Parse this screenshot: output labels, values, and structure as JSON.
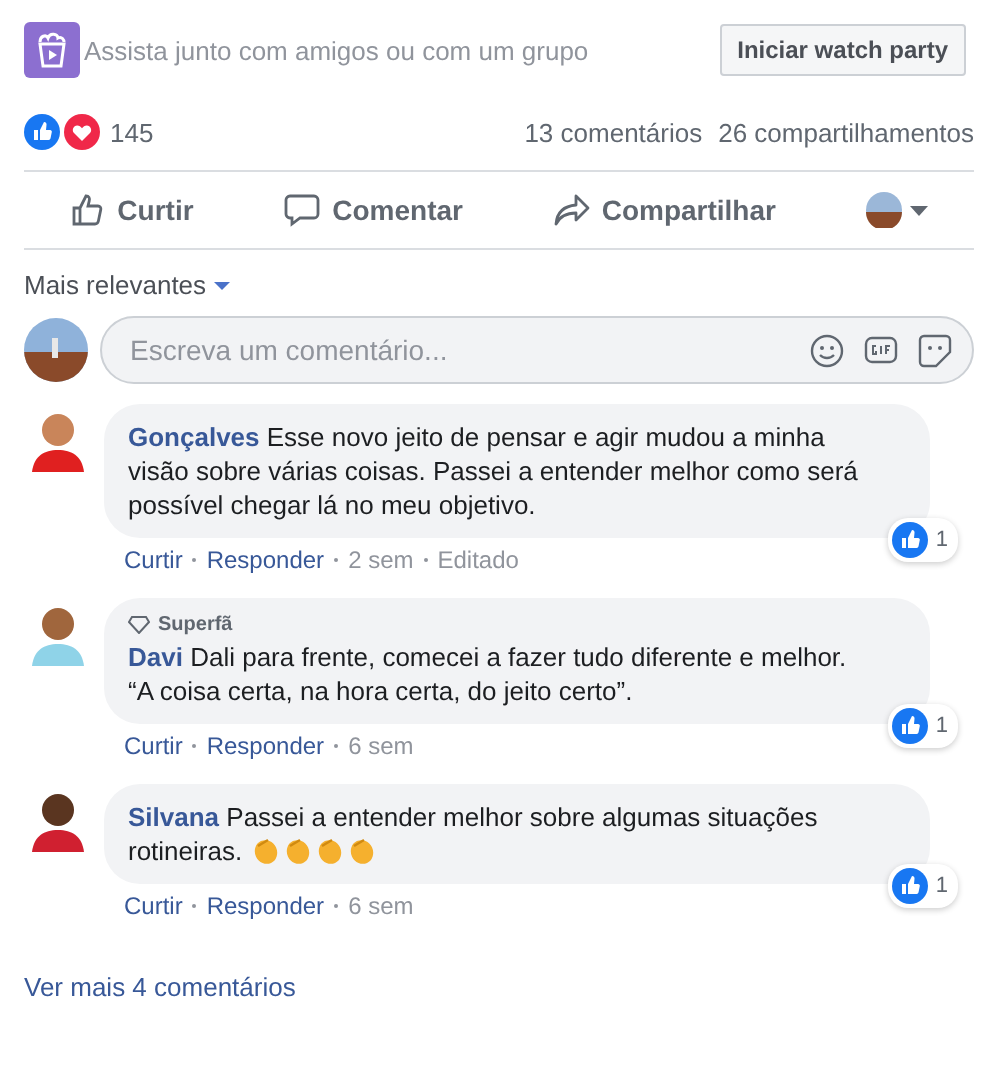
{
  "watch_party": {
    "text": "Assista junto com amigos ou com um grupo",
    "button": "Iniciar watch party"
  },
  "reactions": {
    "icons": [
      {
        "kind": "like"
      },
      {
        "kind": "love"
      }
    ],
    "count": "145",
    "comments": "13 comentários",
    "shares": "26 compartilhamentos"
  },
  "actions": [
    "Curtir",
    "Comentar",
    "Compartilhar"
  ],
  "sort": {
    "label": "Mais relevantes"
  },
  "composer": {
    "placeholder": "Escreva um comentário..."
  },
  "comments": [
    {
      "author": "Gonçalves",
      "text": "Esse novo jeito de pensar e agir mudou a minha visão sobre várias coisas. Passei a entender melhor como será possível chegar lá no meu objetivo.",
      "actions": [
        "Curtir",
        "Responder",
        "2 sem",
        "Editado"
      ],
      "likes": "1"
    },
    {
      "author": "Davi",
      "badge": "Superfã",
      "text": "Dali para frente, comecei a fazer tudo diferente e melhor. “A coisa certa, na hora certa, do jeito certo”.",
      "actions": [
        "Curtir",
        "Responder",
        "6 sem"
      ],
      "likes": "1"
    },
    {
      "author": "Silvana",
      "text": "Passei a entender melhor sobre algumas situações rotineiras.",
      "emojis": [
        {
          "kind": "clap"
        },
        {
          "kind": "clap"
        },
        {
          "kind": "clap"
        },
        {
          "kind": "clap"
        }
      ],
      "actions": [
        "Curtir",
        "Responder",
        "6 sem"
      ],
      "likes": "1"
    }
  ],
  "more": "Ver mais 4 comentários"
}
